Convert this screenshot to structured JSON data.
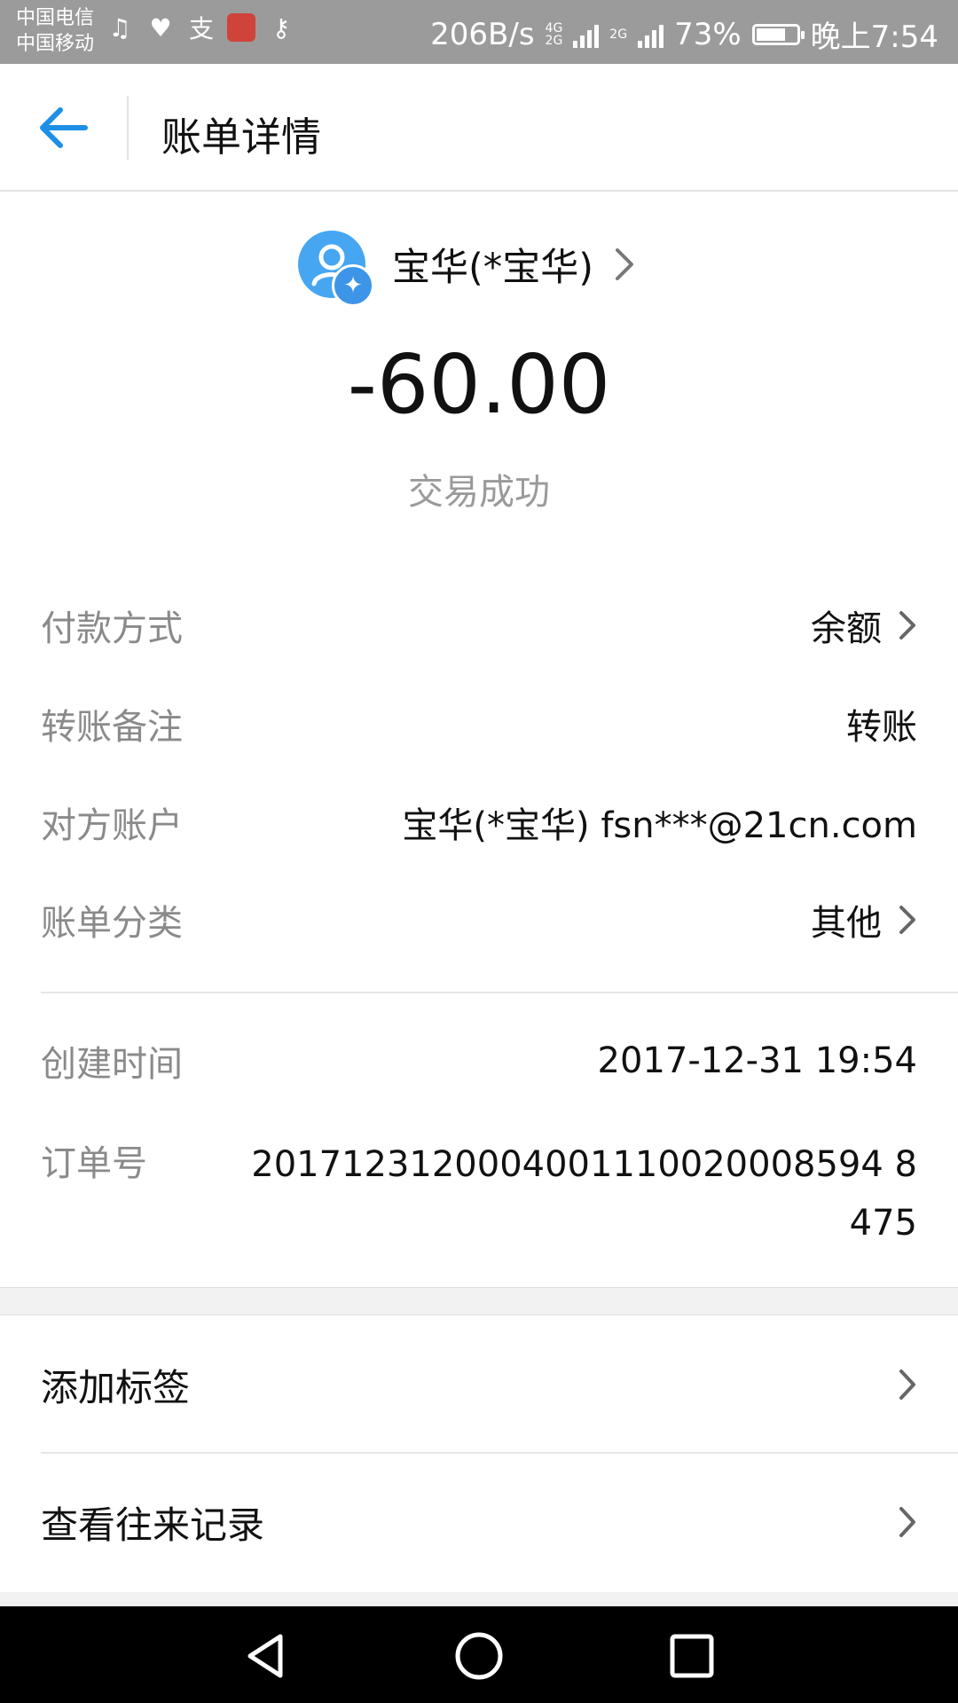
{
  "status_bar": {
    "carrier_1": "中国电信",
    "carrier_2": "中国移动",
    "speed": "206B/s",
    "net_1": "4G",
    "net_2": "2G",
    "net_3": "2G",
    "battery": "73%",
    "battery_level": 0.73,
    "time": "晚上7:54"
  },
  "header": {
    "title": "账单详情"
  },
  "summary": {
    "payee": "宝华(*宝华)",
    "amount": "-60.00",
    "status": "交易成功"
  },
  "details": {
    "payment_method": {
      "label": "付款方式",
      "value": "余额"
    },
    "remark": {
      "label": "转账备注",
      "value": "转账"
    },
    "counterparty": {
      "label": "对方账户",
      "value": "宝华(*宝华) fsn***@21cn.com"
    },
    "category": {
      "label": "账单分类",
      "value": "其他"
    },
    "created": {
      "label": "创建时间",
      "value": "2017-12-31 19:54"
    },
    "order": {
      "label": "订单号",
      "value": "2017123120004001110020008594 8475"
    }
  },
  "actions": {
    "add_tag": "添加标签",
    "history": "查看往来记录"
  },
  "colors": {
    "accent": "#1e8fe6",
    "status_bar": "#9b9b9b",
    "avatar": "#46a6f1"
  }
}
